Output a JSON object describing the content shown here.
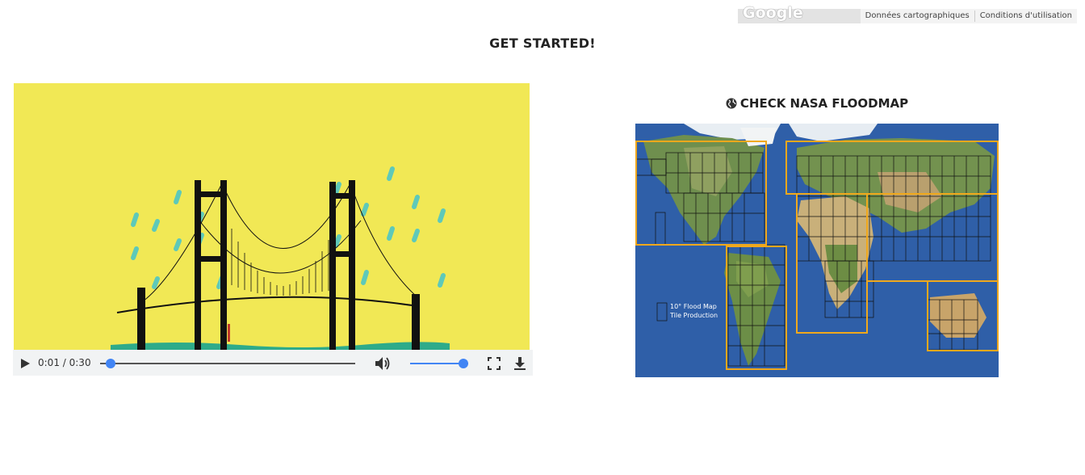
{
  "map_attribution": {
    "logo": "Google",
    "links": [
      "Données cartographiques",
      "Conditions d'utilisation"
    ]
  },
  "heading": "GET STARTED!",
  "video": {
    "current_time": "0:01",
    "separator": " / ",
    "duration": "0:30",
    "progress": 0.04,
    "volume": 1.0,
    "icons": [
      "play-icon",
      "volume-icon",
      "fullscreen-icon",
      "download-icon"
    ]
  },
  "nasa": {
    "title": "CHECK NASA FLOODMAP",
    "icon": "globe-icon",
    "map_label_line1": "10° Flood Map",
    "map_label_line2": "Tile Production"
  },
  "colors": {
    "video_bg": "#f1e855",
    "rain": "#5ec9b9",
    "accent": "#4285f4",
    "tile_border": "#f0a81c",
    "ocean": "#2f5fa8"
  }
}
